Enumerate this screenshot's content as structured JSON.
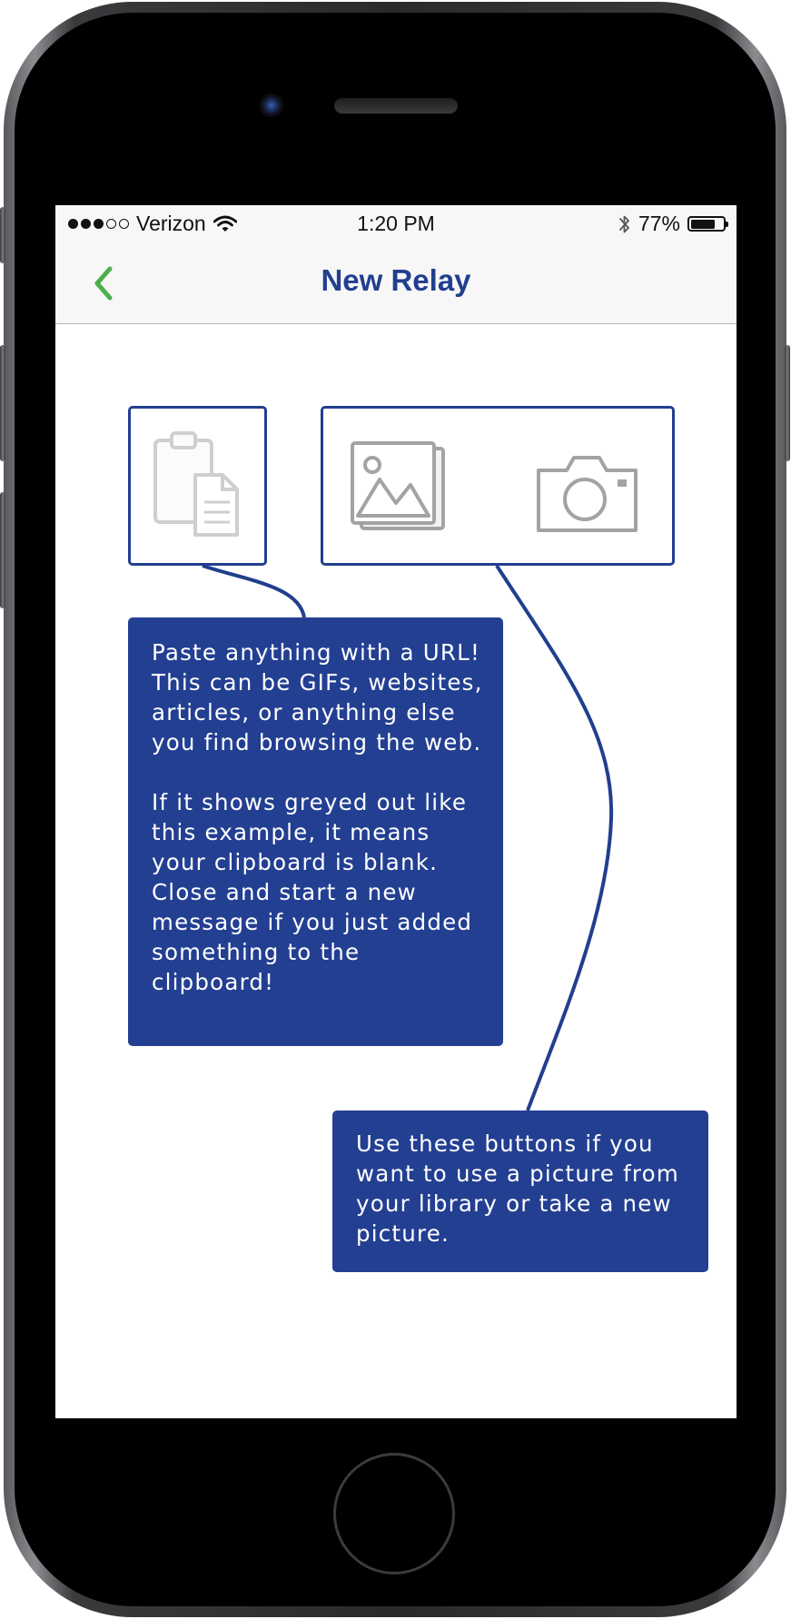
{
  "status_bar": {
    "carrier": "Verizon",
    "time": "1:20 PM",
    "battery_percent": "77%",
    "battery_level": 0.77,
    "signal_bars_filled": 3,
    "signal_bars_total": 5
  },
  "nav": {
    "title": "New Relay",
    "back_icon": "chevron-left-icon",
    "accent_color": "#4cae4c",
    "title_color": "#223f8e"
  },
  "buttons": {
    "paste_icon": "clipboard-icon",
    "photo_library_icon": "photo-library-icon",
    "camera_icon": "camera-icon"
  },
  "tooltips": {
    "paste": {
      "paragraph1": "Paste anything with a URL! This can be GIFs, websites, articles, or anything else you find browsing the web.",
      "paragraph2": "If it shows greyed out like this example, it means your clipboard is blank. Close and start a new message if you just added something to the clipboard!"
    },
    "media": {
      "text": "Use these buttons if you want to use a picture from your library or take a new picture."
    },
    "background_color": "#233f92"
  }
}
